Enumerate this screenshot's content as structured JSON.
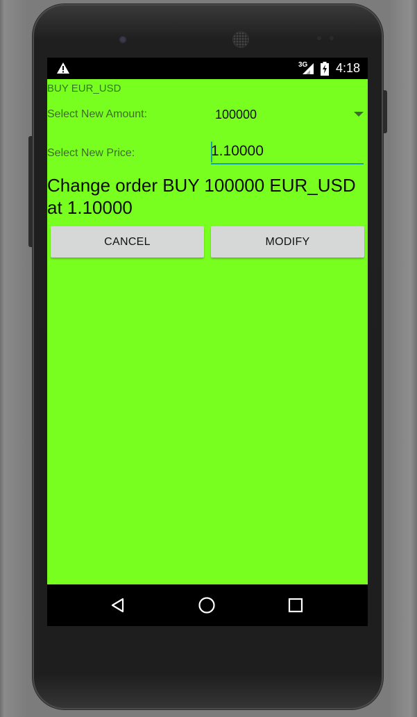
{
  "status_bar": {
    "network": "3G",
    "time": "4:18"
  },
  "app": {
    "title": "BUY EUR_USD"
  },
  "form": {
    "amount_label": "Select New Amount:",
    "amount_value": "100000",
    "price_label": "Select New Price:",
    "price_value": "1.10000"
  },
  "summary": {
    "text": "Change order BUY 100000 EUR_USD at 1.10000"
  },
  "buttons": {
    "cancel": "CANCEL",
    "modify": "MODIFY"
  },
  "colors": {
    "screen_background": "#79ff1f",
    "input_underline": "#1a9fb0",
    "button_background": "#d6d7d7"
  },
  "icons": {
    "status": [
      "warning-icon",
      "signal-icon",
      "battery-charging-icon"
    ],
    "navigation": [
      "back-icon",
      "home-icon",
      "recent-apps-icon"
    ]
  }
}
